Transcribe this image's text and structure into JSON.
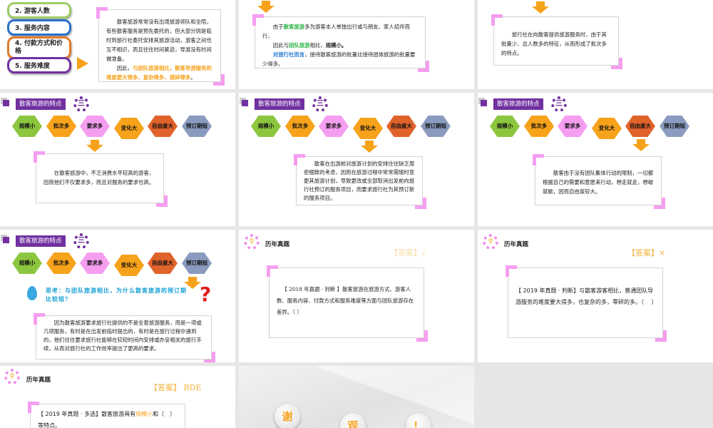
{
  "hex_labels": [
    "规模小",
    "批次多",
    "要求多",
    "变化大",
    "自由度大",
    "预订期短"
  ],
  "hex_colors": [
    "#8cc63f",
    "#f7a21b",
    "#f59ef0",
    "#f7a21b",
    "#e0632b",
    "#8b9bbf"
  ],
  "section_title": "散客旅游的特点",
  "gear_glyph": "三",
  "zhenti_title": "历年真题",
  "slide1": {
    "items": [
      "2. 游客人数",
      "3. 服务内容",
      "4. 付款方式和价格",
      "5. 服务难度"
    ],
    "item_colors": [
      "#9ccc65",
      "#2a6fc9",
      "#e07b2a",
      "#7030a0"
    ],
    "p1": "散客旅游常常没有出境旅游领队和全陪，有些散客服务是预先委托的，但大部分则是临时到旅行社委托安排其旅游活动，游客之间也互不相识，而且往往时间紧迫，导游没有时间做准备。",
    "p2_a": "因此，",
    "p2_b": "与团队旅游相比，散客导游服务的难度要大得多、复杂得多、琐碎得多",
    "p2_c": "。"
  },
  "slide2": {
    "a": "由于",
    "b": "散客旅游",
    "c": "多为游客本人单独出行或与朋友、家人结伴而行，",
    "d": "因此与",
    "e": "团队旅游",
    "f": "相比，",
    "g": "规模小。",
    "h": "对旅行社而言",
    "i": "，接待散客旅游的批量比接待团体旅游的批量要少得多。"
  },
  "slide3": {
    "text": "旅行社在向散客提供旅游服务时，由于其批量少、总人数多的特征，从而形成了批次多的特点。"
  },
  "slide4": {
    "text": "在散客旅游中，不乏消费水平较高的游客，因而他们不仅要求多，而且对服务的要求也高。"
  },
  "slide5": {
    "text": "散客在出游前对旅游计划的安排往往缺乏周密细致的考虑，因而在旅游过程中常常需随时变更其旅游计划，导致更改或全部取消出发前向旅行社预订的服务项目，而要求旅行社为其预订新的服务项目。"
  },
  "slide6": {
    "text": "散客由于没有团队集体行动的限制，一切都根据自己的需要和意愿来行动，想走就走，想歇就歇，因而自由度较大。"
  },
  "slide7": {
    "think": "思考：与团队旅游相比，为什么散客旅游的预订期比较短？",
    "text": "因为散客旅游要求旅行社提供的不是全套旅游服务，而是一项或几项服务，有时是在出发前临时提出的，有时是在旅行过程中遇到的，他们往往要求旅行社能够在较短时间内安排或办妥相关的旅行手续，从而对旅行社的工作效率提出了更高的要求。"
  },
  "slide8": {
    "answer": "【答案】√",
    "text": "【 2018 年真题 · 判断 】散客旅游在旅游方式、游客人数、服务内容、付款方式和服务难度等方面与团队旅游存在差异。（ ）"
  },
  "slide9": {
    "answer": "【答案】×",
    "text": "【 2019 年真题 · 判断】与散客游客相比，普通团队导游服务的难度要大得多，也复杂的多，零碎的多。（　 ）"
  },
  "slide10": {
    "answer": "【答案】 BDE",
    "text_a": "【 2019 年真题 · 多选】散客旅游具有",
    "text_b": "规模小",
    "text_c": "和（　）等特点。"
  },
  "slide11": {
    "chars": [
      "谢",
      "观",
      "！"
    ]
  }
}
